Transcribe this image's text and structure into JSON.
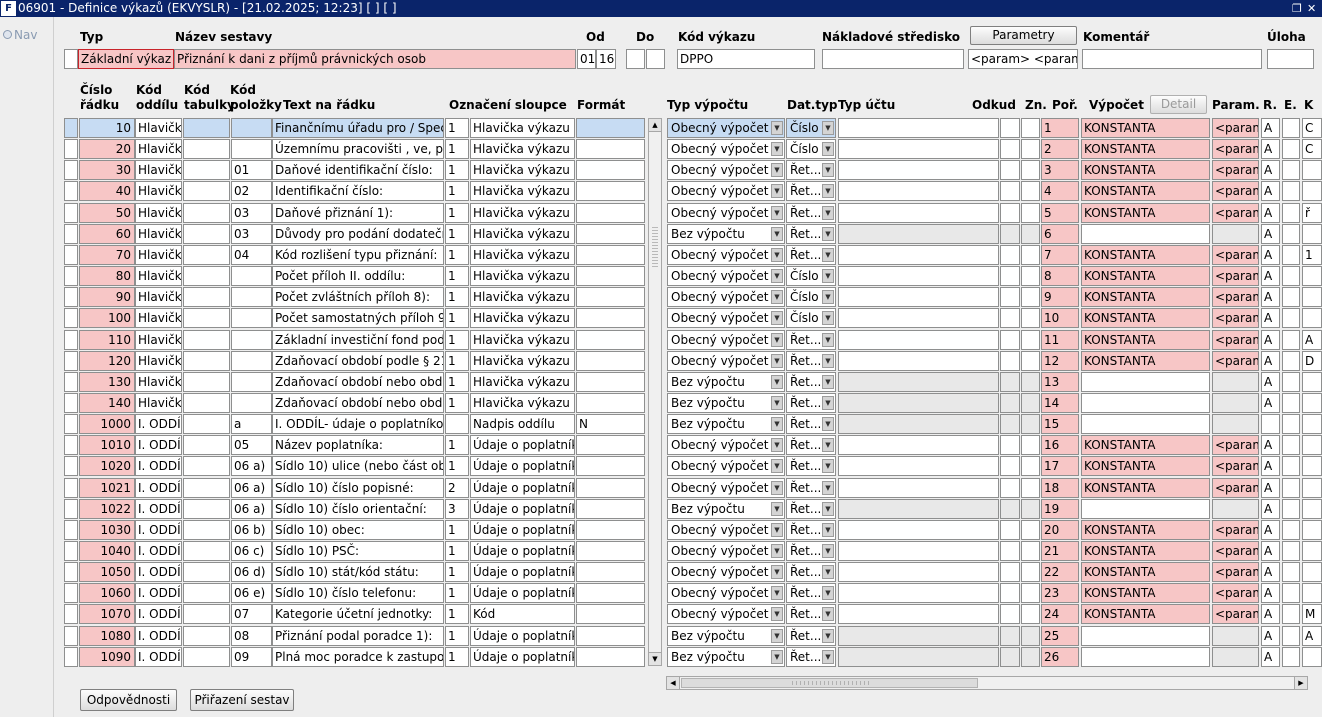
{
  "window": {
    "app_icon_glyph": "F",
    "title": "06901 - Definice výkazů (EKVYSLR) - [21.02.2025; 12:23]  [ ]  [ ]",
    "restore_glyph": "❐",
    "close_glyph": "✕"
  },
  "nav": {
    "label": "Nav"
  },
  "header": {
    "typ_label": "Typ",
    "nazev_label": "Název sestavy",
    "od_label": "Od",
    "do_label": "Do",
    "kod_vykazu_label": "Kód výkazu",
    "nakladove_label": "Nákladové středisko",
    "parametry_button": "Parametry",
    "komentar_label": "Komentář",
    "uloha_label": "Úloha",
    "typ_value": "Základní výkaz",
    "nazev_value": "Přiznání k dani z příjmů právnických osob",
    "od_value_1": "01",
    "od_value_2": "16",
    "do_value_1": "",
    "do_value_2": "",
    "kod_vykazu_value": "DPPO",
    "nakladove_value": "",
    "parametry_value": "<param>  <parame",
    "komentar_value": "",
    "uloha_value": ""
  },
  "columns": {
    "cislo_1": "Číslo",
    "cislo_2": "řádku",
    "kod_oddilu_1": "Kód",
    "kod_oddilu_2": "oddílu",
    "kod_tabulky_1": "Kód",
    "kod_tabulky_2": "tabulky",
    "kod_polozky_1": "Kód",
    "kod_polozky_2": "položky",
    "text": "Text na řádku",
    "oznaceni": "Označení sloupce",
    "format": "Formát",
    "typ_vypoctu": "Typ výpočtu",
    "dat_typ": "Dat.typ",
    "typ_uctu": "Typ účtu",
    "odkud": "Odkud",
    "zn": "Zn.",
    "por": "Poř.",
    "vypocet": "Výpočet",
    "detail_button": "Detail",
    "param": "Param.",
    "r": "R.",
    "e": "E.",
    "k": "K"
  },
  "rows": [
    {
      "cislo": "10",
      "oddil": "Hlavička",
      "tabulka": "",
      "polozka": "",
      "text": "Finančnímu úřadu pro / Specia",
      "n": "1",
      "oznaceni": "Hlavička výkazu",
      "format": "",
      "typ_vypoctu": "Obecný výpočet",
      "dat_typ": "Číslo",
      "typ_uctu": "",
      "odkud": "",
      "zn": "",
      "por": "1",
      "vypocet": "KONSTANTA",
      "param": "<param:",
      "r": "A",
      "e": "",
      "k": "C"
    },
    {
      "cislo": "20",
      "oddil": "Hlavička",
      "tabulka": "",
      "polozka": "",
      "text": "Územnímu pracovišti , ve, pro:",
      "n": "1",
      "oznaceni": "Hlavička výkazu",
      "format": "",
      "typ_vypoctu": "Obecný výpočet",
      "dat_typ": "Číslo",
      "typ_uctu": "",
      "odkud": "",
      "zn": "",
      "por": "2",
      "vypocet": "KONSTANTA",
      "param": "<param:",
      "r": "A",
      "e": "",
      "k": "C"
    },
    {
      "cislo": "30",
      "oddil": "Hlavička",
      "tabulka": "",
      "polozka": "01",
      "text": "Daňové identifikační číslo:",
      "n": "1",
      "oznaceni": "Hlavička výkazu",
      "format": "",
      "typ_vypoctu": "Obecný výpočet",
      "dat_typ": "Řet...",
      "typ_uctu": "",
      "odkud": "",
      "zn": "",
      "por": "3",
      "vypocet": "KONSTANTA",
      "param": "<param:",
      "r": "A",
      "e": "",
      "k": ""
    },
    {
      "cislo": "40",
      "oddil": "Hlavička",
      "tabulka": "",
      "polozka": "02",
      "text": "Identifikační číslo:",
      "n": "1",
      "oznaceni": "Hlavička výkazu",
      "format": "",
      "typ_vypoctu": "Obecný výpočet",
      "dat_typ": "Řet...",
      "typ_uctu": "",
      "odkud": "",
      "zn": "",
      "por": "4",
      "vypocet": "KONSTANTA",
      "param": "<param:",
      "r": "A",
      "e": "",
      "k": ""
    },
    {
      "cislo": "50",
      "oddil": "Hlavička",
      "tabulka": "",
      "polozka": "03",
      "text": "Daňové přiznání 1):",
      "n": "1",
      "oznaceni": "Hlavička výkazu",
      "format": "",
      "typ_vypoctu": "Obecný výpočet",
      "dat_typ": "Řet...",
      "typ_uctu": "",
      "odkud": "",
      "zn": "",
      "por": "5",
      "vypocet": "KONSTANTA",
      "param": "<param:",
      "r": "A",
      "e": "",
      "k": "ř"
    },
    {
      "cislo": "60",
      "oddil": "Hlavička",
      "tabulka": "",
      "polozka": "03",
      "text": "Důvody pro podání dodatečnéh",
      "n": "1",
      "oznaceni": "Hlavička výkazu",
      "format": "",
      "typ_vypoctu": "Bez výpočtu",
      "dat_typ": "Řet...",
      "typ_uctu": "",
      "odkud": "",
      "zn": "",
      "por": "6",
      "vypocet": "",
      "param": "",
      "r": "A",
      "e": "",
      "k": ""
    },
    {
      "cislo": "70",
      "oddil": "Hlavička",
      "tabulka": "",
      "polozka": "04",
      "text": "Kód rozlišení typu přiznání:",
      "n": "1",
      "oznaceni": "Hlavička výkazu",
      "format": "",
      "typ_vypoctu": "Obecný výpočet",
      "dat_typ": "Řet...",
      "typ_uctu": "",
      "odkud": "",
      "zn": "",
      "por": "7",
      "vypocet": "KONSTANTA",
      "param": "<param:",
      "r": "A",
      "e": "",
      "k": "1"
    },
    {
      "cislo": "80",
      "oddil": "Hlavička",
      "tabulka": "",
      "polozka": "",
      "text": "Počet příloh II. oddílu:",
      "n": "1",
      "oznaceni": "Hlavička výkazu",
      "format": "",
      "typ_vypoctu": "Obecný výpočet",
      "dat_typ": "Číslo",
      "typ_uctu": "",
      "odkud": "",
      "zn": "",
      "por": "8",
      "vypocet": "KONSTANTA",
      "param": "<param:",
      "r": "A",
      "e": "",
      "k": ""
    },
    {
      "cislo": "90",
      "oddil": "Hlavička",
      "tabulka": "",
      "polozka": "",
      "text": "Počet zvláštních příloh 8):",
      "n": "1",
      "oznaceni": "Hlavička výkazu",
      "format": "",
      "typ_vypoctu": "Obecný výpočet",
      "dat_typ": "Číslo",
      "typ_uctu": "",
      "odkud": "",
      "zn": "",
      "por": "9",
      "vypocet": "KONSTANTA",
      "param": "<param:",
      "r": "A",
      "e": "",
      "k": ""
    },
    {
      "cislo": "100",
      "oddil": "Hlavička",
      "tabulka": "",
      "polozka": "",
      "text": "Počet samostatných příloh 9):",
      "n": "1",
      "oznaceni": "Hlavička výkazu",
      "format": "",
      "typ_vypoctu": "Obecný výpočet",
      "dat_typ": "Číslo",
      "typ_uctu": "",
      "odkud": "",
      "zn": "",
      "por": "10",
      "vypocet": "KONSTANTA",
      "param": "<param:",
      "r": "A",
      "e": "",
      "k": ""
    },
    {
      "cislo": "110",
      "oddil": "Hlavička",
      "tabulka": "",
      "polozka": "",
      "text": "Základní investiční fond podle §",
      "n": "1",
      "oznaceni": "Hlavička výkazu",
      "format": "",
      "typ_vypoctu": "Obecný výpočet",
      "dat_typ": "Řet...",
      "typ_uctu": "",
      "odkud": "",
      "zn": "",
      "por": "11",
      "vypocet": "KONSTANTA",
      "param": "<param:",
      "r": "A",
      "e": "",
      "k": "A"
    },
    {
      "cislo": "120",
      "oddil": "Hlavička",
      "tabulka": "",
      "polozka": "",
      "text": "Zdaňovací období podle § 21a",
      "n": "1",
      "oznaceni": "Hlavička výkazu",
      "format": "",
      "typ_vypoctu": "Obecný výpočet",
      "dat_typ": "Řet...",
      "typ_uctu": "",
      "odkud": "",
      "zn": "",
      "por": "12",
      "vypocet": "KONSTANTA",
      "param": "<param:",
      "r": "A",
      "e": "",
      "k": "D"
    },
    {
      "cislo": "130",
      "oddil": "Hlavička",
      "tabulka": "",
      "polozka": "",
      "text": "Zdaňovací období nebo období",
      "n": "1",
      "oznaceni": "Hlavička výkazu",
      "format": "",
      "typ_vypoctu": "Bez výpočtu",
      "dat_typ": "Řet...",
      "typ_uctu": "",
      "odkud": "",
      "zn": "",
      "por": "13",
      "vypocet": "",
      "param": "",
      "r": "A",
      "e": "",
      "k": ""
    },
    {
      "cislo": "140",
      "oddil": "Hlavička",
      "tabulka": "",
      "polozka": "",
      "text": "Zdaňovací období nebo období",
      "n": "1",
      "oznaceni": "Hlavička výkazu",
      "format": "",
      "typ_vypoctu": "Bez výpočtu",
      "dat_typ": "Řet...",
      "typ_uctu": "",
      "odkud": "",
      "zn": "",
      "por": "14",
      "vypocet": "",
      "param": "",
      "r": "A",
      "e": "",
      "k": ""
    },
    {
      "cislo": "1000",
      "oddil": "I. ODDÍL",
      "tabulka": "",
      "polozka": "a",
      "text": "I. ODDÍL- údaje o poplatníkovi",
      "n": "",
      "oznaceni": "Nadpis oddílu",
      "format": "N",
      "typ_vypoctu": "Bez výpočtu",
      "dat_typ": "Řet...",
      "typ_uctu": "",
      "odkud": "",
      "zn": "",
      "por": "15",
      "vypocet": "",
      "param": "",
      "r": "",
      "e": "",
      "k": ""
    },
    {
      "cislo": "1010",
      "oddil": "I. ODDÍL",
      "tabulka": "",
      "polozka": "05",
      "text": "Název poplatníka:",
      "n": "1",
      "oznaceni": "Údaje o poplatníkc",
      "format": "",
      "typ_vypoctu": "Obecný výpočet",
      "dat_typ": "Řet...",
      "typ_uctu": "",
      "odkud": "",
      "zn": "",
      "por": "16",
      "vypocet": "KONSTANTA",
      "param": "<param:",
      "r": "A",
      "e": "",
      "k": ""
    },
    {
      "cislo": "1020",
      "oddil": "I. ODDÍL",
      "tabulka": "",
      "polozka": "06 a)",
      "text": "Sídlo 10) ulice (nebo část obce",
      "n": "1",
      "oznaceni": "Údaje o poplatníkc",
      "format": "",
      "typ_vypoctu": "Obecný výpočet",
      "dat_typ": "Řet...",
      "typ_uctu": "",
      "odkud": "",
      "zn": "",
      "por": "17",
      "vypocet": "KONSTANTA",
      "param": "<param:",
      "r": "A",
      "e": "",
      "k": ""
    },
    {
      "cislo": "1021",
      "oddil": "I. ODDÍL",
      "tabulka": "",
      "polozka": "06 a)",
      "text": "Sídlo 10) číslo popisné:",
      "n": "2",
      "oznaceni": "Údaje o poplatníkc",
      "format": "",
      "typ_vypoctu": "Obecný výpočet",
      "dat_typ": "Řet...",
      "typ_uctu": "",
      "odkud": "",
      "zn": "",
      "por": "18",
      "vypocet": "KONSTANTA",
      "param": "<param:",
      "r": "A",
      "e": "",
      "k": ""
    },
    {
      "cislo": "1022",
      "oddil": "I. ODDÍL",
      "tabulka": "",
      "polozka": "06 a)",
      "text": "Sídlo 10) číslo orientační:",
      "n": "3",
      "oznaceni": "Údaje o poplatníkc",
      "format": "",
      "typ_vypoctu": "Bez výpočtu",
      "dat_typ": "Řet...",
      "typ_uctu": "",
      "odkud": "",
      "zn": "",
      "por": "19",
      "vypocet": "",
      "param": "",
      "r": "A",
      "e": "",
      "k": ""
    },
    {
      "cislo": "1030",
      "oddil": "I. ODDÍL",
      "tabulka": "",
      "polozka": "06 b)",
      "text": "Sídlo 10) obec:",
      "n": "1",
      "oznaceni": "Údaje o poplatníkc",
      "format": "",
      "typ_vypoctu": "Obecný výpočet",
      "dat_typ": "Řet...",
      "typ_uctu": "",
      "odkud": "",
      "zn": "",
      "por": "20",
      "vypocet": "KONSTANTA",
      "param": "<param:",
      "r": "A",
      "e": "",
      "k": ""
    },
    {
      "cislo": "1040",
      "oddil": "I. ODDÍL",
      "tabulka": "",
      "polozka": "06 c)",
      "text": "Sídlo 10) PSČ:",
      "n": "1",
      "oznaceni": "Údaje o poplatníkc",
      "format": "",
      "typ_vypoctu": "Obecný výpočet",
      "dat_typ": "Řet...",
      "typ_uctu": "",
      "odkud": "",
      "zn": "",
      "por": "21",
      "vypocet": "KONSTANTA",
      "param": "<param:",
      "r": "A",
      "e": "",
      "k": ""
    },
    {
      "cislo": "1050",
      "oddil": "I. ODDÍL",
      "tabulka": "",
      "polozka": "06 d)",
      "text": "Sídlo 10) stát/kód státu:",
      "n": "1",
      "oznaceni": "Údaje o poplatníkc",
      "format": "",
      "typ_vypoctu": "Obecný výpočet",
      "dat_typ": "Řet...",
      "typ_uctu": "",
      "odkud": "",
      "zn": "",
      "por": "22",
      "vypocet": "KONSTANTA",
      "param": "<param:",
      "r": "A",
      "e": "",
      "k": ""
    },
    {
      "cislo": "1060",
      "oddil": "I. ODDÍL",
      "tabulka": "",
      "polozka": "06 e)",
      "text": "Sídlo 10) číslo telefonu:",
      "n": "1",
      "oznaceni": "Údaje o poplatníkc",
      "format": "",
      "typ_vypoctu": "Obecný výpočet",
      "dat_typ": "Řet...",
      "typ_uctu": "",
      "odkud": "",
      "zn": "",
      "por": "23",
      "vypocet": "KONSTANTA",
      "param": "<param:",
      "r": "A",
      "e": "",
      "k": ""
    },
    {
      "cislo": "1070",
      "oddil": "I. ODDÍL",
      "tabulka": "",
      "polozka": "07",
      "text": "Kategorie účetní jednotky:",
      "n": "1",
      "oznaceni": "Kód",
      "format": "",
      "typ_vypoctu": "Obecný výpočet",
      "dat_typ": "Řet...",
      "typ_uctu": "",
      "odkud": "",
      "zn": "",
      "por": "24",
      "vypocet": "KONSTANTA",
      "param": "<param:",
      "r": "A",
      "e": "",
      "k": "M"
    },
    {
      "cislo": "1080",
      "oddil": "I. ODDÍL",
      "tabulka": "",
      "polozka": "08",
      "text": "Přiznání podal poradce 1):",
      "n": "1",
      "oznaceni": "Údaje o poplatníkc",
      "format": "",
      "typ_vypoctu": "Bez výpočtu",
      "dat_typ": "Řet...",
      "typ_uctu": "",
      "odkud": "",
      "zn": "",
      "por": "25",
      "vypocet": "",
      "param": "",
      "r": "A",
      "e": "",
      "k": "A"
    },
    {
      "cislo": "1090",
      "oddil": "I. ODDÍL",
      "tabulka": "",
      "polozka": "09",
      "text": "Plná moc poradce k zastupová",
      "n": "1",
      "oznaceni": "Údaje o poplatníkc",
      "format": "",
      "typ_vypoctu": "Bez výpočtu",
      "dat_typ": "Řet...",
      "typ_uctu": "",
      "odkud": "",
      "zn": "",
      "por": "26",
      "vypocet": "",
      "param": "",
      "r": "A",
      "e": "",
      "k": ""
    }
  ],
  "footer": {
    "odpovednosti_button": "Odpovědnosti",
    "prirazeni_button": "Přiřazení sestav"
  },
  "scroll": {
    "up": "▲",
    "down": "▼",
    "left": "◀",
    "right": "▶"
  },
  "colors": {
    "required_pink": "#f7c6c6",
    "selected_blue": "#c7dcf3",
    "titlebar_blue": "#0a246a"
  }
}
